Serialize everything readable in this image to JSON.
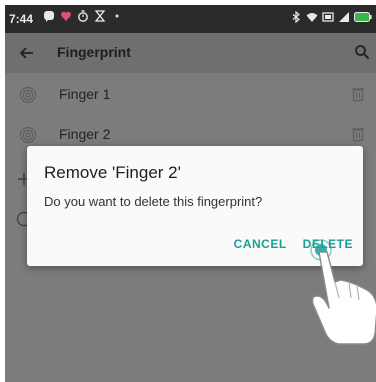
{
  "status_bar": {
    "time": "7:44",
    "left_icons": [
      "notification-icon",
      "heart-icon",
      "timer-icon",
      "hourglass-icon",
      "dot-icon"
    ],
    "right_icons": [
      "bluetooth-icon",
      "wifi-icon",
      "battery-saver-icon",
      "signal-icon",
      "battery-icon"
    ]
  },
  "app_bar": {
    "title": "Fingerprint",
    "back_icon": "arrow-left-icon",
    "search_icon": "search-icon"
  },
  "fingerprints": [
    {
      "label": "Finger 1"
    },
    {
      "label": "Finger 2"
    }
  ],
  "dialog": {
    "title": "Remove 'Finger 2'",
    "message": "Do you want to delete this fingerprint?",
    "cancel_label": "CANCEL",
    "delete_label": "DELETE"
  },
  "colors": {
    "accent": "#1a9f94",
    "scrim": "#7c7c7c"
  }
}
